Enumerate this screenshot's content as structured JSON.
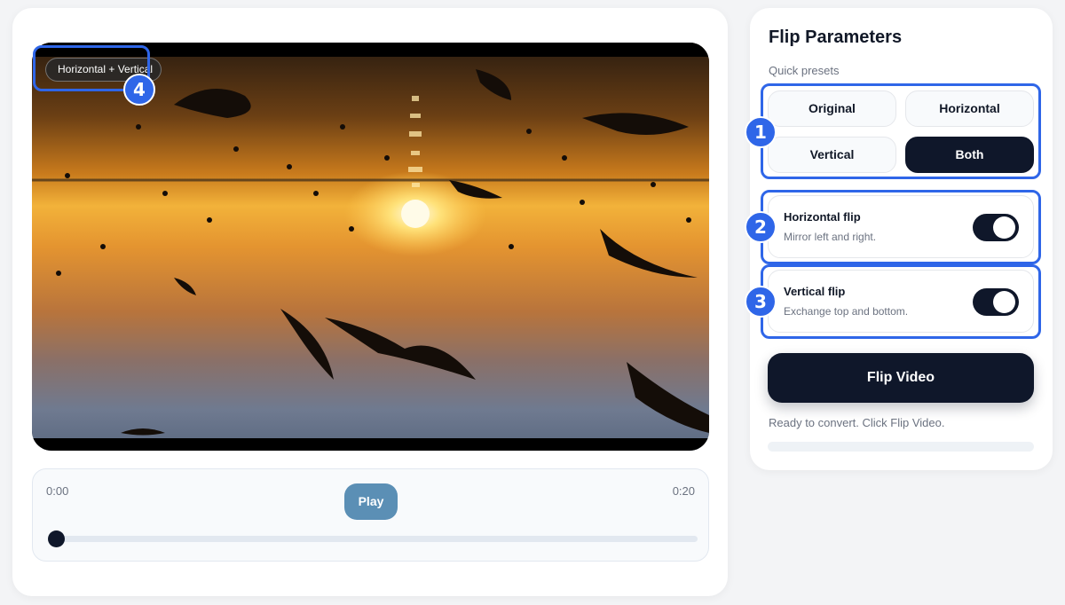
{
  "player": {
    "badge": "Horizontal + Vertical",
    "time_start": "0:00",
    "time_end": "0:20",
    "play_label": "Play",
    "progress": 0
  },
  "panel": {
    "title": "Flip Parameters",
    "presets_label": "Quick presets",
    "presets": [
      {
        "label": "Original",
        "active": false
      },
      {
        "label": "Horizontal",
        "active": false
      },
      {
        "label": "Vertical",
        "active": false
      },
      {
        "label": "Both",
        "active": true
      }
    ],
    "toggles": [
      {
        "title": "Horizontal flip",
        "desc": "Mirror left and right.",
        "on": true
      },
      {
        "title": "Vertical flip",
        "desc": "Exchange top and bottom.",
        "on": true
      }
    ],
    "flip_label": "Flip Video",
    "status": "Ready to convert. Click Flip Video.",
    "conversion_progress": 0
  },
  "annotations": [
    "1",
    "2",
    "3",
    "4"
  ],
  "colors": {
    "accent": "#0f172a",
    "annotation": "#2f66e8",
    "play_button": "#5b8fb5"
  }
}
